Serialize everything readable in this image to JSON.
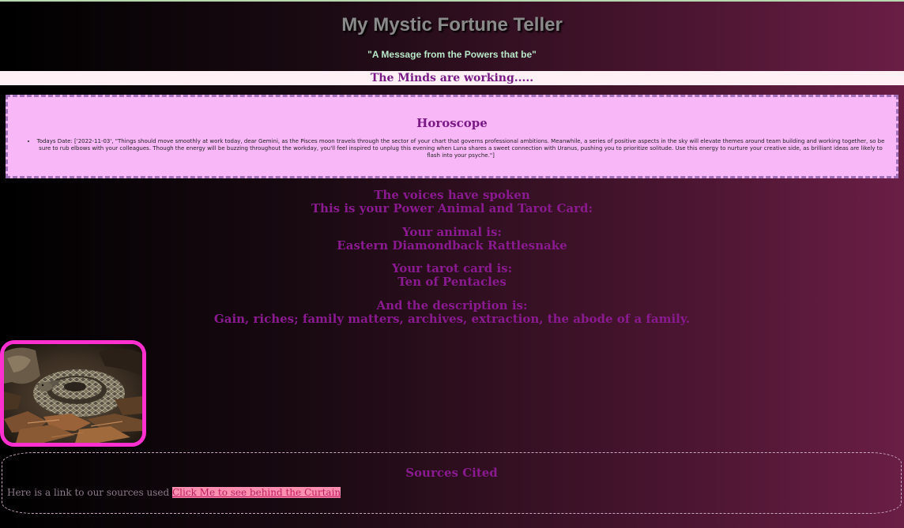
{
  "header": {
    "title": "My Mystic Fortune Teller",
    "tagline": "\"A Message from the Powers that be\""
  },
  "status": {
    "working": "The Minds are working....."
  },
  "horoscope": {
    "title": "Horoscope",
    "item": "Todays Date: ['2022-11-03', \"Things should move smoothly at work today, dear Gemini, as the Pisces moon travels through the sector of your chart that governs professional ambitions. Meanwhile, a series of positive aspects in the sky will elevate themes around team building and working together, so be sure to rub elbows with your colleagues. Though the energy will be buzzing throughout the workday, you'll feel inspired to unplug this evening when Luna shares a sweet connection with Uranus, pushing you to prioritize solitude. Use this energy to nurture your creative side, as brilliant ideas are likely to flash into your psyche.\"]"
  },
  "reading": {
    "spoken_line1": "The voices have spoken",
    "spoken_line2": "This is your Power Animal and Tarot Card:",
    "animal_label": "Your animal is:",
    "animal_value": "Eastern Diamondback Rattlesnake",
    "tarot_label": "Your tarot card is:",
    "tarot_value": "Ten of Pentacles",
    "description_label": "And the description is:",
    "description_value": "Gain, riches; family matters, archives, extraction, the abode of a family."
  },
  "sources": {
    "title": "Sources Cited",
    "prefix": "Here is a link to our sources used",
    "link_text": "Click Me to see behind the Curtain"
  },
  "colors": {
    "accent_purple": "#8a1a90",
    "horoscope_bg": "#f8b8f8",
    "image_border": "#ff2fd0",
    "link_bg": "#ff8fb0"
  }
}
